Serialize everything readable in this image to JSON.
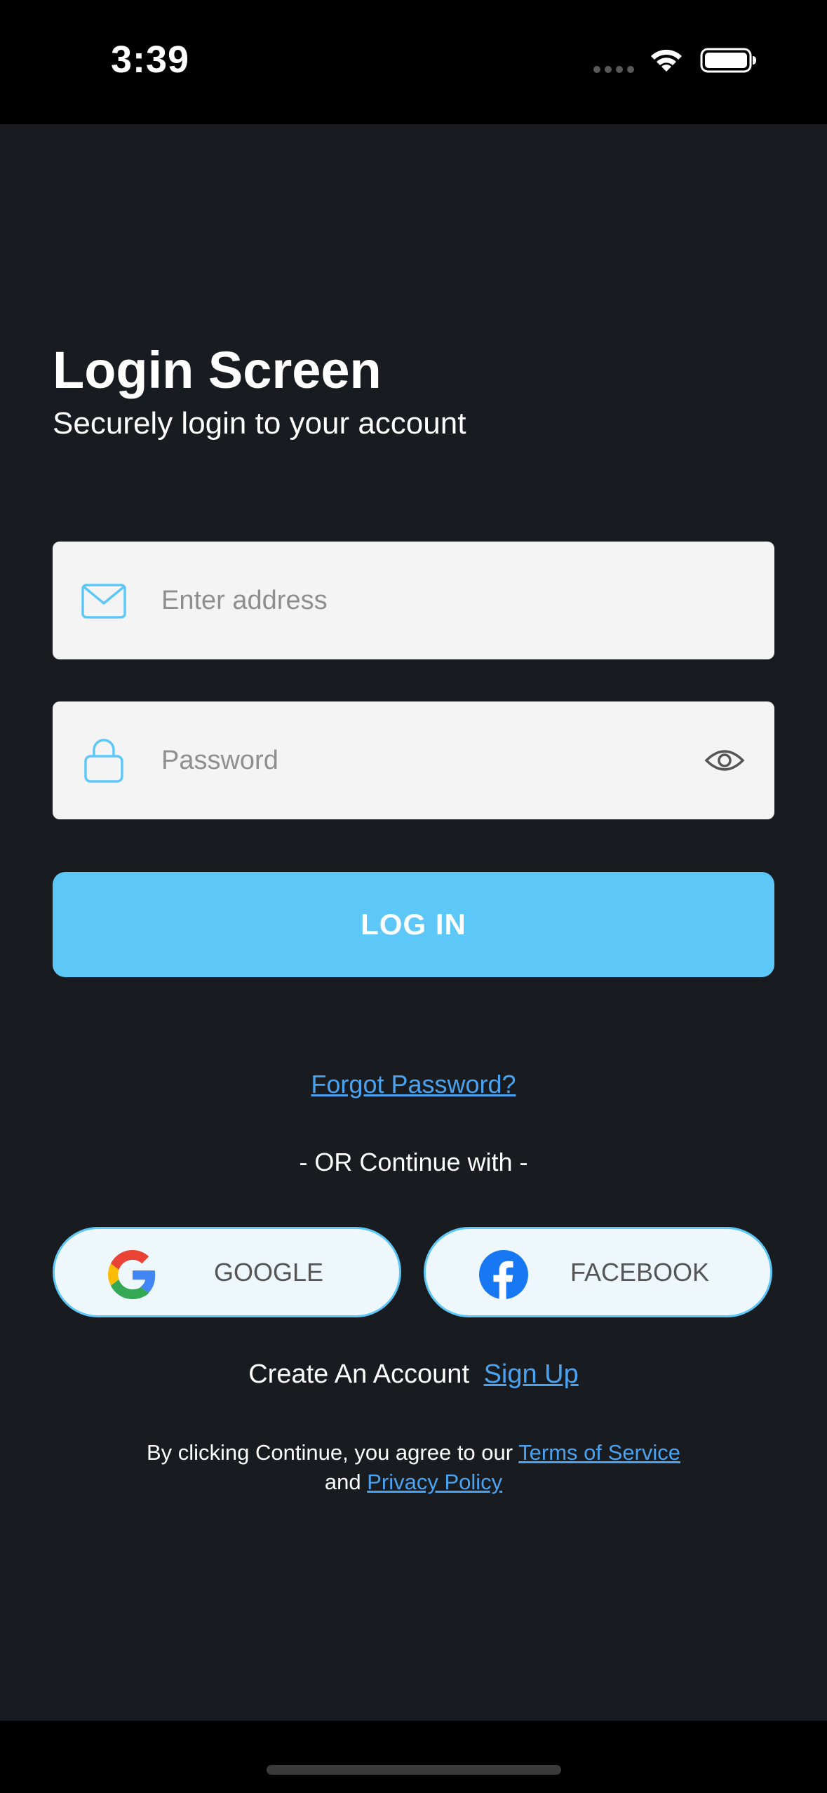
{
  "status_bar": {
    "time": "3:39",
    "icons": [
      "cellular-dots-icon",
      "wifi-icon",
      "battery-icon"
    ]
  },
  "header": {
    "title": "Login Screen",
    "subtitle": "Securely login to your account"
  },
  "form": {
    "email": {
      "placeholder": "Enter address",
      "value": "",
      "icon": "envelope-icon"
    },
    "password": {
      "placeholder": "Password",
      "value": "",
      "icon": "lock-icon",
      "toggle_icon": "eye-icon"
    },
    "login_label": "LOG IN"
  },
  "forgot_password": "Forgot Password?",
  "divider_text": "- OR Continue with -",
  "social": {
    "google_label": "GOOGLE",
    "facebook_label": "FACEBOOK"
  },
  "signup": {
    "prompt": "Create An Account",
    "link": "Sign Up"
  },
  "terms": {
    "prefix": "By clicking Continue, you agree to our",
    "terms_link": "Terms of Service",
    "connector": "and",
    "privacy_link": "Privacy Policy"
  },
  "colors": {
    "background": "#181b20",
    "accent": "#5dc8f8",
    "link": "#4aa3f0",
    "field_bg": "#f4f4f4"
  }
}
